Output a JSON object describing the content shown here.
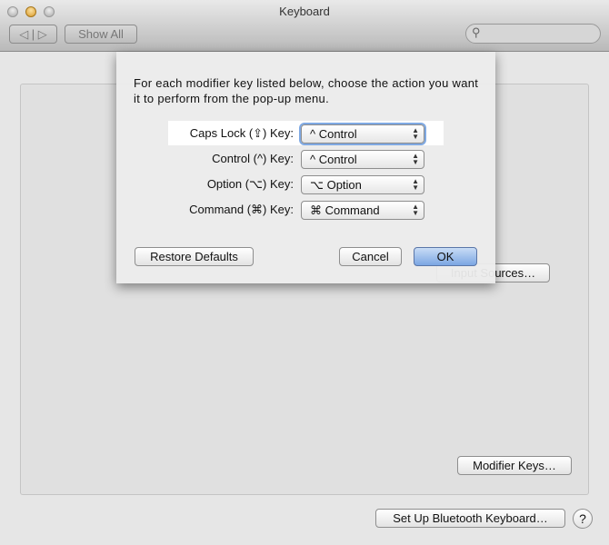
{
  "window": {
    "title": "Keyboard",
    "show_all": "Show All",
    "back": "◁",
    "forward": "▷",
    "search_placeholder": ""
  },
  "background": {
    "input_sources": "Input Sources…",
    "modifier_keys": "Modifier Keys…",
    "bluetooth": "Set Up Bluetooth Keyboard…",
    "help": "?"
  },
  "sheet": {
    "description": "For each modifier key listed below, choose the action you want it to perform from the pop-up menu.",
    "rows": [
      {
        "label": "Caps Lock (⇪) Key:",
        "value": "^ Control"
      },
      {
        "label": "Control (^) Key:",
        "value": "^ Control"
      },
      {
        "label": "Option (⌥) Key:",
        "value": "⌥ Option"
      },
      {
        "label": "Command (⌘) Key:",
        "value": "⌘ Command"
      }
    ],
    "restore": "Restore Defaults",
    "cancel": "Cancel",
    "ok": "OK"
  }
}
